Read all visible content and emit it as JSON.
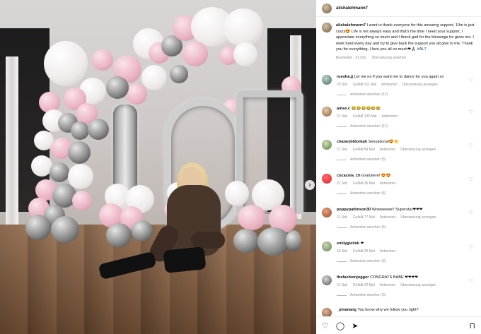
{
  "post": {
    "username": "alishalehmann7",
    "caption_user": "alishalehmann7",
    "caption_text": "I want to thank everyone for this amazing support, 10m is just crazy😍 Life is not always easy and that's the time I need your support, I appreciate everything so much and I thank god for the blessings he gives me. I work hard every day and try to give back the support you all give to me. Thank you for everything, I love you all so much❤🙏🏽",
    "caption_tag": "#AL7",
    "caption_meta_edited": "Bearbeitet · 21 Std.",
    "caption_meta_translate": "Übersetzung ansehen"
  },
  "comments": [
    {
      "user": "ruesha.jj",
      "text": "Let me no if you want me to dance for you again xo",
      "time": "20 Std.",
      "likes": "Gefällt 311 Mal",
      "reply": "Antworten",
      "translate": "Übersetzung anzeigen",
      "replies": "Antworten ansehen (12)"
    },
    {
      "user": "ainee.c",
      "text": "😂😂😂😂😂😂",
      "time": "21 Std.",
      "likes": "Gefällt 100 Mal",
      "reply": "Antworten",
      "translate": "",
      "replies": "Antworten ansehen (11)"
    },
    {
      "user": "chaneybhlorkah",
      "text": "Sensational😍👏",
      "time": "21 Std.",
      "likes": "Gefällt 84 Mal",
      "reply": "Antworten",
      "translate": "Übersetzung anzeigen",
      "replies": "Antworten ansehen (5)"
    },
    {
      "user": "cocacola_ch",
      "text": "Gratuliere! 😍😍",
      "time": "21 Std.",
      "likes": "Gefällt 36 Mal",
      "reply": "Antworten",
      "translate": "",
      "replies": "Antworten ansehen (6)"
    },
    {
      "user": "poppypattinson30",
      "text": "Wowweeee!! Superstar❤❤❤",
      "time": "21 Std.",
      "likes": "Gefällt 77 Mal",
      "reply": "Antworten",
      "translate": "Übersetzung anzeigen",
      "replies": "Antworten ansehen (5)"
    },
    {
      "user": "emilygielnik",
      "text": "❤",
      "time": "18 Std.",
      "likes": "Gefällt 29 Mal",
      "reply": "Antworten",
      "translate": "",
      "replies": "Antworten ansehen (2)"
    },
    {
      "user": "thefashionjogger",
      "text": "CONGRATS BABE ❤❤❤❤",
      "time": "21 Std.",
      "likes": "Gefällt 42 Mal",
      "reply": "Antworten",
      "translate": "Übersetzung anzeigen",
      "replies": "Antworten ansehen (5)"
    },
    {
      "user": "_pmanang",
      "text": "You know why we follow you right?",
      "time": "",
      "likes": "",
      "reply": "",
      "translate": "",
      "replies": ""
    }
  ],
  "icons": {
    "like": "heart-icon",
    "comment": "comment-icon",
    "share": "share-icon",
    "save": "bookmark-icon",
    "next": "chevron-right-icon"
  },
  "colors": {
    "link": "#00376b",
    "muted": "#8e8e8e",
    "avatar_cocacola": "#e41e2b"
  }
}
